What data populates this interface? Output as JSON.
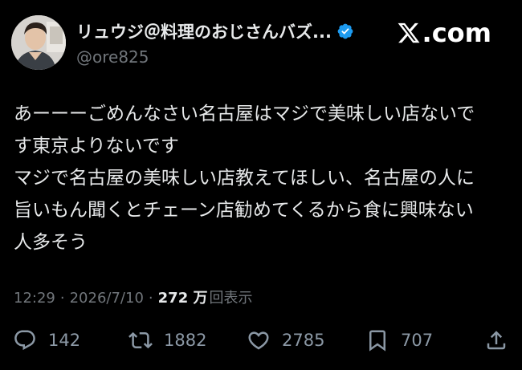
{
  "author": {
    "display_name": "リュウジ＠料理のおじさんバズ...",
    "handle": "@ore825",
    "verified": true
  },
  "brand": {
    "logo_icon": "x-logo-icon",
    "domain_suffix": ".com"
  },
  "tweet": {
    "lines": [
      "あーーーごめんなさい名古屋はマジで美味しい店ないで",
      "す東京よりないです",
      "マジで名古屋の美味しい店教えてほしい、名古屋の人に",
      "旨いもん聞くとチェーン店勧めてくるから食に興味ない",
      "人多そう"
    ]
  },
  "meta": {
    "time": "12:29",
    "separator": "·",
    "date": "2026/7/10",
    "separator2": "·",
    "views_count": "272 万",
    "views_label": "回表示"
  },
  "actions": {
    "reply": {
      "icon": "reply-icon",
      "count": "142"
    },
    "repost": {
      "icon": "repost-icon",
      "count": "1882"
    },
    "like": {
      "icon": "heart-icon",
      "count": "2785"
    },
    "bookmark": {
      "icon": "bookmark-icon",
      "count": "707"
    },
    "share": {
      "icon": "share-icon"
    }
  },
  "colors": {
    "background": "#000000",
    "text": "#e7e9ea",
    "secondary": "#71767b",
    "verified": "#1d9bf0"
  }
}
